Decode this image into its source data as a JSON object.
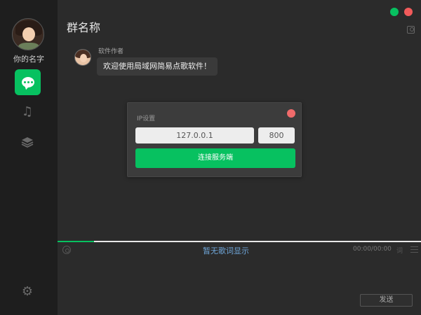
{
  "user": {
    "name": "你的名字"
  },
  "nav": {
    "items": [
      "chat",
      "music",
      "layers"
    ],
    "settings": "gear"
  },
  "header": {
    "title": "群名称"
  },
  "message": {
    "sender": "软件作者",
    "text": "欢迎使用局域网简易点歌软件！"
  },
  "dialog": {
    "title": "IP设置",
    "ip_value": "127.0.0.1",
    "port_value": "800",
    "connect_label": "连接服务端"
  },
  "player": {
    "progress": 0.1,
    "lyric": "暂无歌词显示",
    "time": "00:00/00:00",
    "lyric_icon": "词"
  },
  "footer": {
    "send_label": "发送"
  },
  "colors": {
    "accent": "#07c160",
    "close": "#f25b5b"
  }
}
